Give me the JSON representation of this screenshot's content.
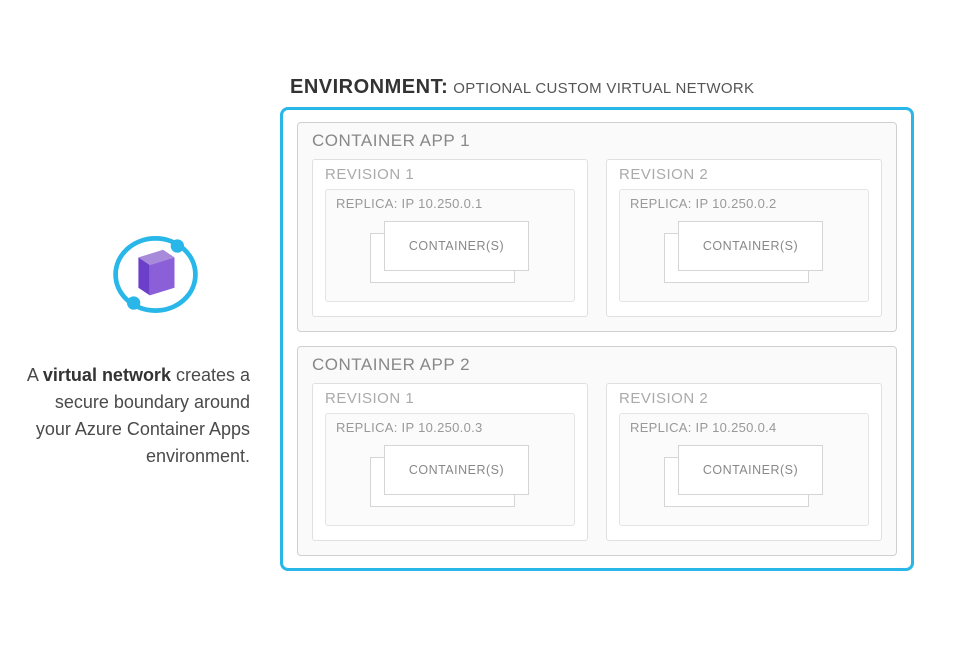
{
  "sidebar": {
    "caption_prefix": "A ",
    "caption_bold": "virtual network",
    "caption_rest": " creates a secure boundary around your Azure Container Apps environment."
  },
  "environment": {
    "title_label": "ENVIRONMENT:",
    "title_sub": "OPTIONAL CUSTOM VIRTUAL NETWORK"
  },
  "apps": [
    {
      "title": "CONTAINER APP 1",
      "revisions": [
        {
          "title": "REVISION 1",
          "replica_label": "REPLICA: IP 10.250.0.1",
          "container_label": "CONTAINER(S)"
        },
        {
          "title": "REVISION 2",
          "replica_label": "REPLICA: IP 10.250.0.2",
          "container_label": "CONTAINER(S)"
        }
      ]
    },
    {
      "title": "CONTAINER APP 2",
      "revisions": [
        {
          "title": "REVISION 1",
          "replica_label": "REPLICA: IP 10.250.0.3",
          "container_label": "CONTAINER(S)"
        },
        {
          "title": "REVISION 2",
          "replica_label": "REPLICA: IP 10.250.0.4",
          "container_label": "CONTAINER(S)"
        }
      ]
    }
  ],
  "colors": {
    "accent": "#29B6E8",
    "icon_purple": "#7B4FD8"
  }
}
